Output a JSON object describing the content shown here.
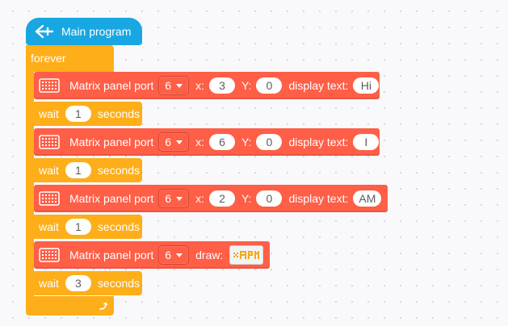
{
  "hat": {
    "label": "Main program",
    "icon": "flag-icon"
  },
  "forever": {
    "label": "forever",
    "loop_icon": "loop-arrow-icon"
  },
  "rows": [
    {
      "kind": "matrix",
      "label": "Matrix panel port",
      "port": "6",
      "x_label": "x:",
      "x": "3",
      "y_label": "Y:",
      "y": "0",
      "display_label": "display text:",
      "text": "Hi"
    },
    {
      "kind": "wait",
      "label": "wait",
      "value": "1",
      "unit": "seconds"
    },
    {
      "kind": "matrix",
      "label": "Matrix panel port",
      "port": "6",
      "x_label": "x:",
      "x": "6",
      "y_label": "Y:",
      "y": "0",
      "display_label": "display text:",
      "text": "I"
    },
    {
      "kind": "wait",
      "label": "wait",
      "value": "1",
      "unit": "seconds"
    },
    {
      "kind": "matrix",
      "label": "Matrix panel port",
      "port": "6",
      "x_label": "x:",
      "x": "2",
      "y_label": "Y:",
      "y": "0",
      "display_label": "display text:",
      "text": "AM"
    },
    {
      "kind": "wait",
      "label": "wait",
      "value": "1",
      "unit": "seconds"
    },
    {
      "kind": "matrix_draw",
      "label": "Matrix panel port",
      "port": "6",
      "draw_label": "draw:"
    },
    {
      "kind": "wait",
      "label": "wait",
      "value": "3",
      "unit": "seconds"
    }
  ],
  "colors": {
    "hat": "#18a7e2",
    "control": "#fdae19",
    "matrix": "#ff5e47"
  }
}
